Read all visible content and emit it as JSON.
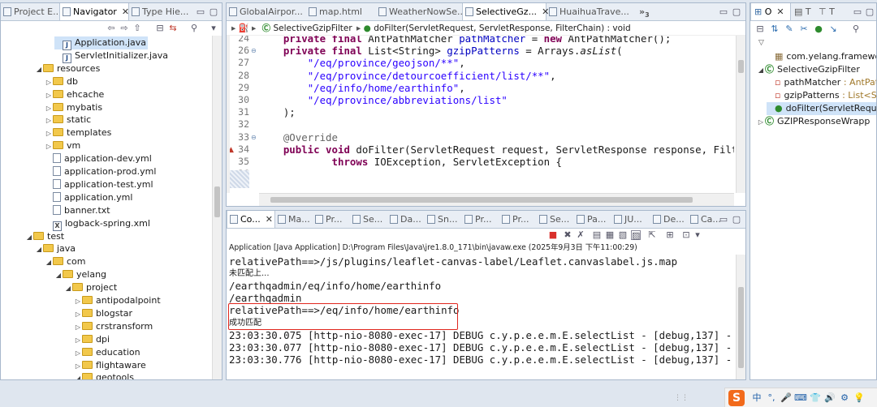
{
  "left_tabs": {
    "project_explorer": "Project E...",
    "navigator": "Navigator",
    "type_hierarchy": "Type Hie..."
  },
  "tree": [
    {
      "indent": 5,
      "type": "java",
      "label": "Application.java",
      "selected": true
    },
    {
      "indent": 5,
      "type": "java",
      "label": "ServletInitializer.java"
    },
    {
      "indent": 3,
      "type": "folder",
      "label": "resources",
      "open": true
    },
    {
      "indent": 4,
      "type": "folder",
      "label": "db"
    },
    {
      "indent": 4,
      "type": "folder",
      "label": "ehcache"
    },
    {
      "indent": 4,
      "type": "folder",
      "label": "mybatis"
    },
    {
      "indent": 4,
      "type": "folder",
      "label": "static"
    },
    {
      "indent": 4,
      "type": "folder",
      "label": "templates"
    },
    {
      "indent": 4,
      "type": "folder",
      "label": "vm"
    },
    {
      "indent": 4,
      "type": "file",
      "label": "application-dev.yml"
    },
    {
      "indent": 4,
      "type": "file",
      "label": "application-prod.yml"
    },
    {
      "indent": 4,
      "type": "file",
      "label": "application-test.yml"
    },
    {
      "indent": 4,
      "type": "file",
      "label": "application.yml"
    },
    {
      "indent": 4,
      "type": "file",
      "label": "banner.txt"
    },
    {
      "indent": 4,
      "type": "xml",
      "label": "logback-spring.xml"
    },
    {
      "indent": 2,
      "type": "folder",
      "label": "test",
      "open": true
    },
    {
      "indent": 3,
      "type": "folder",
      "label": "java",
      "open": true
    },
    {
      "indent": 4,
      "type": "folder",
      "label": "com",
      "open": true
    },
    {
      "indent": 5,
      "type": "folder",
      "label": "yelang",
      "open": true
    },
    {
      "indent": 6,
      "type": "folder",
      "label": "project",
      "open": true
    },
    {
      "indent": 7,
      "type": "folder",
      "label": "antipodalpoint"
    },
    {
      "indent": 7,
      "type": "folder",
      "label": "blogstar"
    },
    {
      "indent": 7,
      "type": "folder",
      "label": "crstransform"
    },
    {
      "indent": 7,
      "type": "folder",
      "label": "dpi"
    },
    {
      "indent": 7,
      "type": "folder",
      "label": "education"
    },
    {
      "indent": 7,
      "type": "folder",
      "label": "flightaware"
    },
    {
      "indent": 7,
      "type": "folder",
      "label": "geotools",
      "open": true
    }
  ],
  "editor_tabs": [
    "GlobalAirpor...",
    "map.html",
    "WeatherNowSe...",
    "SelectiveGz...",
    "HuaihuaTrave..."
  ],
  "editor_tab_overflow": "»",
  "editor_tab_overflow_count": "3",
  "breadcrumb": {
    "class": "SelectiveGzipFilter",
    "method": "doFilter(ServletRequest, ServletResponse, FilterChain) : void"
  },
  "code": [
    {
      "n": "24",
      "parts": [
        [
          "",
          "    "
        ],
        [
          "kw",
          "private final "
        ],
        [
          "",
          "AntPathMatcher "
        ],
        [
          "fld",
          "pathMatcher"
        ],
        [
          "",
          " = "
        ],
        [
          "kw",
          "new "
        ],
        [
          "",
          "AntPathMatcher();"
        ]
      ]
    },
    {
      "n": "26",
      "parts": [
        [
          "",
          "    "
        ],
        [
          "kw",
          "private final "
        ],
        [
          "",
          "List<String> "
        ],
        [
          "fld",
          "gzipPatterns"
        ],
        [
          "",
          " = Arrays."
        ],
        [
          "it",
          "asList"
        ],
        [
          "",
          "("
        ]
      ]
    },
    {
      "n": "27",
      "parts": [
        [
          "",
          "        "
        ],
        [
          "str",
          "\"/eq/province/geojson/**\""
        ],
        [
          "",
          ","
        ]
      ]
    },
    {
      "n": "28",
      "parts": [
        [
          "",
          "        "
        ],
        [
          "str",
          "\"/eq/province/detourcoefficient/list/**\""
        ],
        [
          "",
          ","
        ]
      ]
    },
    {
      "n": "29",
      "parts": [
        [
          "",
          "        "
        ],
        [
          "str",
          "\"/eq/info/home/earthinfo\""
        ],
        [
          "",
          ","
        ]
      ]
    },
    {
      "n": "30",
      "parts": [
        [
          "",
          "        "
        ],
        [
          "str",
          "\"/eq/province/abbreviations/list\""
        ]
      ]
    },
    {
      "n": "31",
      "parts": [
        [
          "",
          "    );"
        ]
      ]
    },
    {
      "n": "32",
      "parts": [
        [
          "",
          ""
        ]
      ]
    },
    {
      "n": "33",
      "parts": [
        [
          "",
          "    "
        ],
        [
          "ann",
          "@Override"
        ]
      ]
    },
    {
      "n": "34",
      "parts": [
        [
          "",
          "    "
        ],
        [
          "kw",
          "public void "
        ],
        [
          "",
          "doFilter(ServletRequest request, ServletResponse response, Filter"
        ]
      ]
    },
    {
      "n": "35",
      "parts": [
        [
          "",
          "            "
        ],
        [
          "kw",
          "throws "
        ],
        [
          "",
          "IOException, ServletException {"
        ]
      ]
    },
    {
      "n": "36",
      "parts": [
        [
          "",
          ""
        ]
      ]
    }
  ],
  "console_tabs": [
    "Co...",
    "Ma...",
    "Pr...",
    "Se...",
    "Da...",
    "Sn...",
    "Pr...",
    "Pr...",
    "Se...",
    "Pa...",
    "JU...",
    "De...",
    "Ca..."
  ],
  "console_header": "Application [Java Application] D:\\Program Files\\Java\\jre1.8.0_171\\bin\\javaw.exe (2025年9月3日 下午11:00:29)",
  "console_lines": [
    {
      "text": "relativePath==>/js/plugins/leaflet-canvas-label/Leaflet.canvaslabel.js.map",
      "cjk": false
    },
    {
      "text": "未匹配上...",
      "cjk": true
    },
    {
      "text": "/earthqadmin/eq/info/home/earthinfo",
      "cjk": false
    },
    {
      "text": "/earthqadmin",
      "cjk": false
    },
    {
      "text": "relativePath==>/eq/info/home/earthinfo",
      "cjk": false
    },
    {
      "text": "成功匹配",
      "cjk": true
    },
    {
      "text": "23:03:30.075 [http-nio-8080-exec-17] DEBUG c.y.p.e.e.m.E.selectList - [debug,137] - ==>",
      "cjk": false
    },
    {
      "text": "23:03:30.077 [http-nio-8080-exec-17] DEBUG c.y.p.e.e.m.E.selectList - [debug,137] - ==>",
      "cjk": false
    },
    {
      "text": "23:03:30.776 [http-nio-8080-exec-17] DEBUG c.y.p.e.e.m.E.selectList - [debug,137] - <==",
      "cjk": false
    }
  ],
  "outline": [
    {
      "indent": 1,
      "icon": "package",
      "label": "com.yelang.framework.ir"
    },
    {
      "indent": 0,
      "icon": "class",
      "label": "SelectiveGzipFilter",
      "open": true
    },
    {
      "indent": 1,
      "icon": "field",
      "label": "pathMatcher",
      "suffix": " : AntPath"
    },
    {
      "indent": 1,
      "icon": "field",
      "label": "gzipPatterns",
      "suffix": " : List<Str"
    },
    {
      "indent": 1,
      "icon": "method",
      "label": "doFilter(ServletReque",
      "selected": true
    },
    {
      "indent": 0,
      "icon": "class",
      "label": "GZIPResponseWrapp",
      "collapsed": true
    }
  ],
  "taskbar": [
    "中",
    "°,",
    "🎤",
    "⌨",
    "👕",
    "🔊",
    "⚙",
    "💡"
  ],
  "colors": {
    "accent_red": "#e0261e",
    "sogou_orange": "#f26a1b"
  }
}
